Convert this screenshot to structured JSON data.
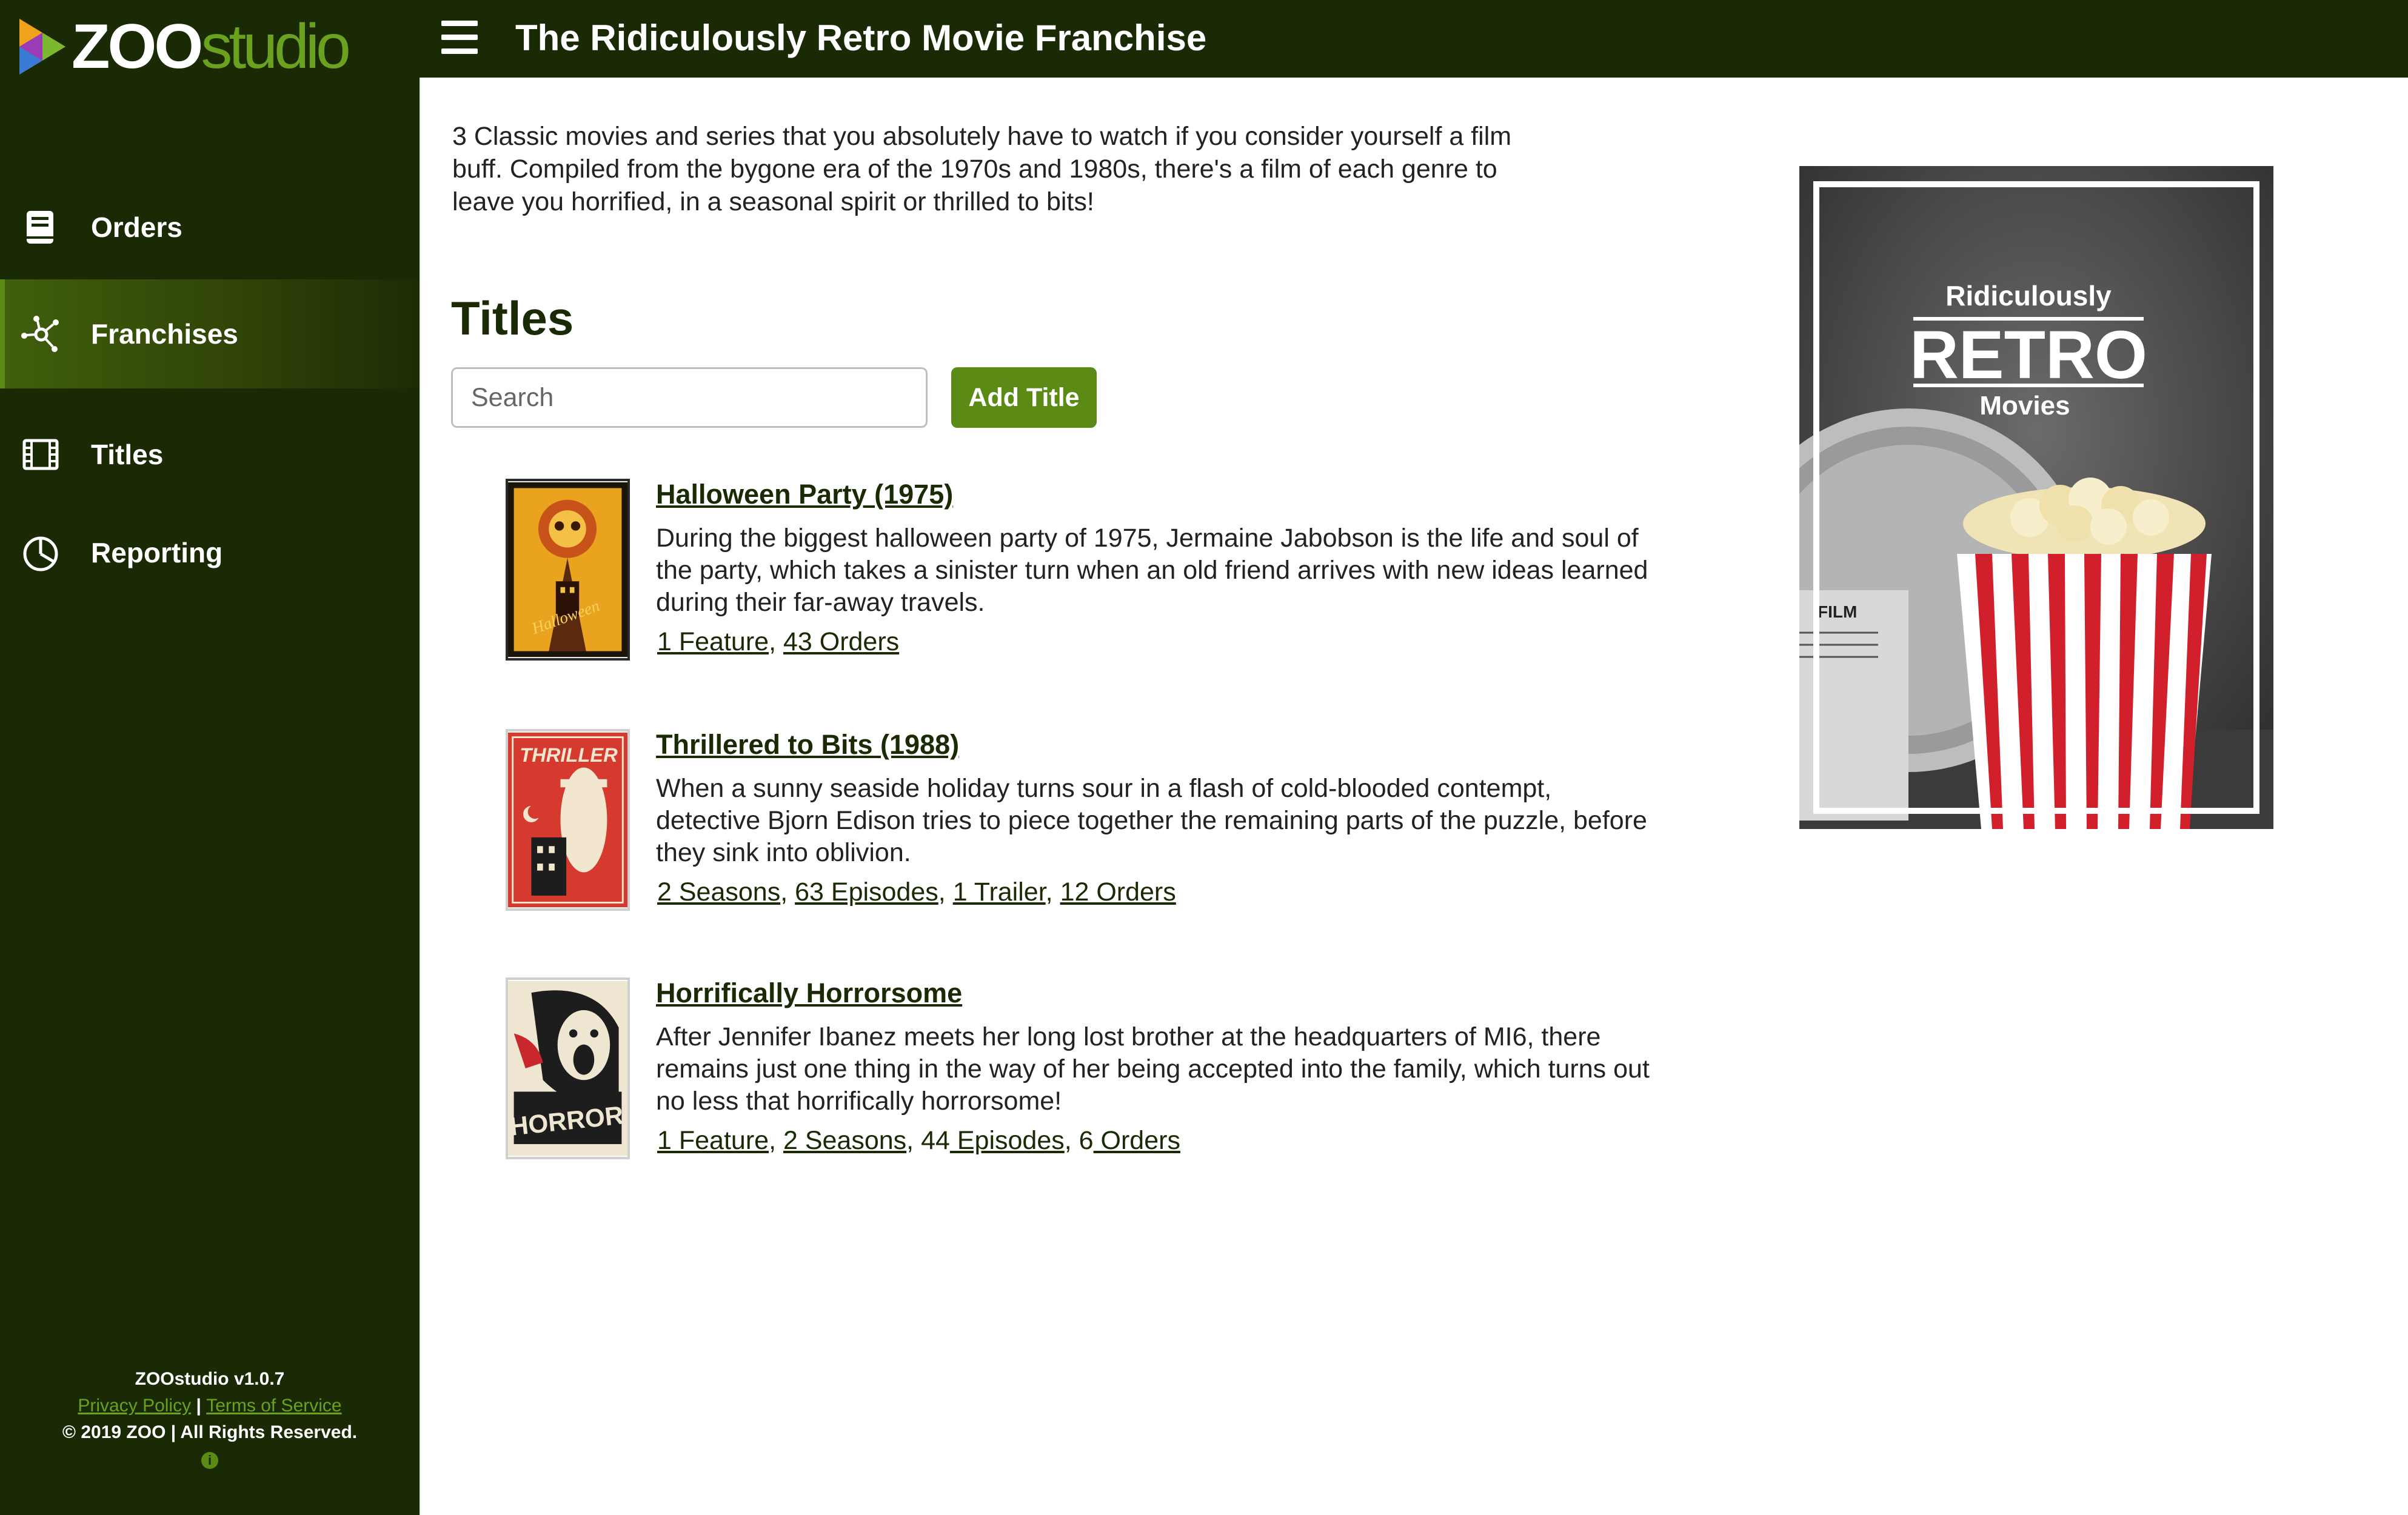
{
  "app": {
    "logo_zoo": "ZOO",
    "logo_studio": "studio"
  },
  "sidebar": {
    "items": [
      {
        "label": "Orders",
        "icon": "book-icon",
        "active": false
      },
      {
        "label": "Franchises",
        "icon": "network-icon",
        "active": true
      },
      {
        "label": "Titles",
        "icon": "film-icon",
        "active": false
      },
      {
        "label": "Reporting",
        "icon": "pie-chart-icon",
        "active": false
      }
    ],
    "footer": {
      "version": "ZOOstudio v1.0.7",
      "privacy": "Privacy Policy",
      "separator": "|",
      "terms": "Terms of Service",
      "copyright": "© 2019 ZOO | All Rights Reserved.",
      "info_icon": "i"
    }
  },
  "header": {
    "title": "The Ridiculously Retro Movie Franchise"
  },
  "main": {
    "intro": "3 Classic movies and series that you absolutely have to watch if you consider yourself a film buff. Compiled from the bygone era of the 1970s and 1980s, there's a film of each genre to leave you horrified, in a seasonal spirit or thrilled to bits!",
    "section_title": "Titles",
    "search_placeholder": "Search",
    "add_button": "Add Title",
    "titles": [
      {
        "name": "Halloween Party (1975)",
        "description": "During the biggest halloween party of 1975, Jermaine Jabobson is the life and soul of the party, which takes a sinister turn when an old friend arrives with new ideas learned during their far-away travels.",
        "links": [
          "1 Feature",
          "43 Orders"
        ],
        "poster_text": "Halloween"
      },
      {
        "name": "Thrillered to Bits (1988)",
        "description": "When a sunny seaside holiday turns sour in a flash of cold-blooded contempt, detective Bjorn Edison tries to piece together the remaining parts of the puzzle, before they sink into oblivion.",
        "links": [
          "2 Seasons",
          "63 Episodes",
          "1 Trailer",
          "12 Orders"
        ],
        "poster_text": "THRILLER"
      },
      {
        "name": "Horrifically Horrorsome",
        "description": "After Jennifer Ibanez meets her long lost brother at the headquarters of MI6, there remains just one thing in the way of her being accepted into the family, which turns out no less that horrifically horrorsome!",
        "links_prefix": [
          "",
          "",
          "44",
          "6"
        ],
        "links": [
          "1 Feature",
          "2 Seasons",
          " Episodes",
          " Orders"
        ],
        "poster_text": "HORROR"
      }
    ],
    "cover": {
      "line1": "Ridiculously",
      "line2": "RETRO",
      "line3": "Movies",
      "reel_text": "FILM"
    }
  },
  "colors": {
    "sidebar_bg": "#1a2a05",
    "accent": "#5b8b14",
    "link_green": "#6aa11e"
  }
}
